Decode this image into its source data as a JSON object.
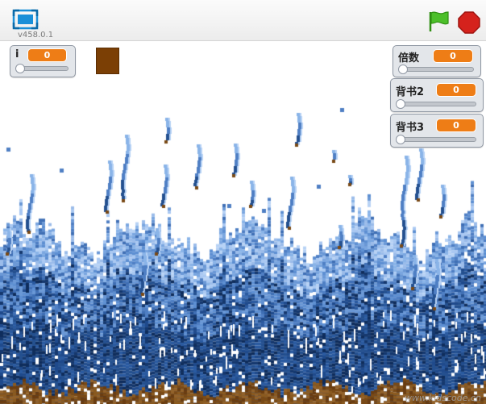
{
  "app": {
    "version": "v458.0.1",
    "watermark": "www.kidscode.cn"
  },
  "icons": {
    "fullscreen": "fullscreen-icon",
    "green_flag": "green-flag-icon",
    "stop": "stop-sign-icon"
  },
  "monitors": {
    "i": {
      "label": "i",
      "value": "0",
      "slider_level": 0
    },
    "multiplier": {
      "label": "倍数",
      "value": "0",
      "slider_level": 0
    },
    "bg2": {
      "label": "背书2",
      "value": "0",
      "slider_level": 0
    },
    "bg3": {
      "label": "背书3",
      "value": "0",
      "slider_level": 0
    }
  },
  "colors": {
    "monitor_value": "#ee7d16",
    "ground": "#7a4a16",
    "water_dark": "#15386e",
    "water_light": "#8ab4e8",
    "brown_sprite": "#7b3f05",
    "flag": "#4cbf2a",
    "stop": "#d5221c"
  }
}
